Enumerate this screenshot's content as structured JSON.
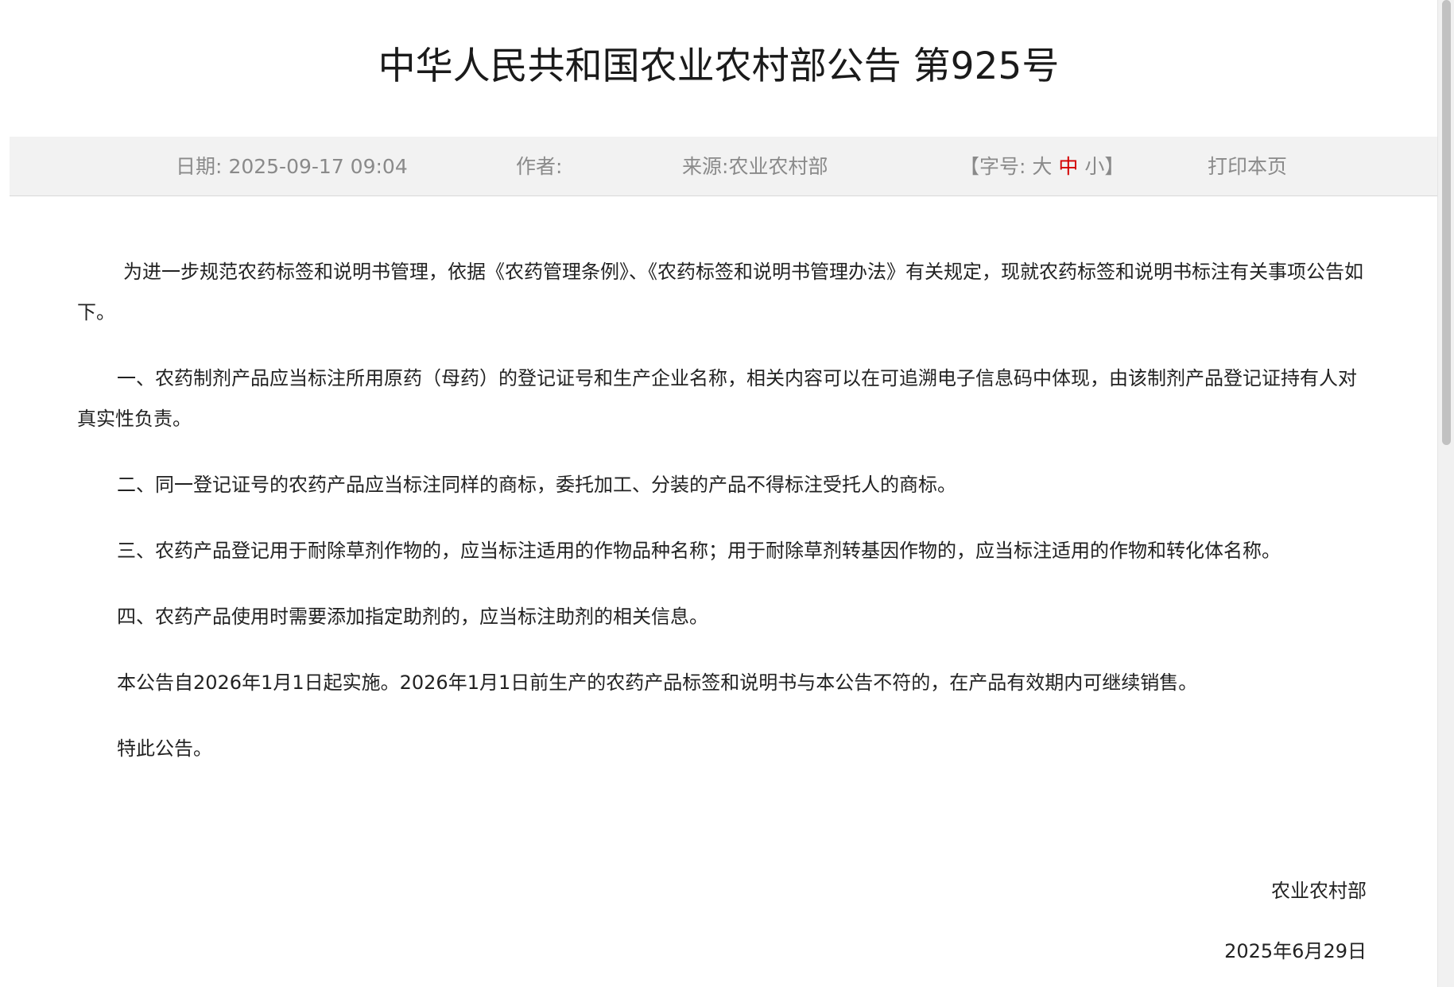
{
  "article": {
    "title": "中华人民共和国农业农村部公告 第925号"
  },
  "meta": {
    "date_label": "日期:",
    "date_value": "2025-09-17 09:04",
    "author_label": "作者:",
    "source_label": "来源:",
    "source_value": "农业农村部",
    "fontsize_open": "【字号:",
    "fontsize_large": "大",
    "fontsize_medium": "中",
    "fontsize_small": "小",
    "fontsize_close": "】",
    "fontsize_active": "中",
    "print_label": "打印本页",
    "active_color": "#d40000"
  },
  "body": {
    "paragraphs": [
      "为进一步规范农药标签和说明书管理，依据《农药管理条例》、《农药标签和说明书管理办法》有关规定，现就农药标签和说明书标注有关事项公告如下。",
      "一、农药制剂产品应当标注所用原药（母药）的登记证号和生产企业名称，相关内容可以在可追溯电子信息码中体现，由该制剂产品登记证持有人对真实性负责。",
      "二、同一登记证号的农药产品应当标注同样的商标，委托加工、分装的产品不得标注受托人的商标。",
      "三、农药产品登记用于耐除草剂作物的，应当标注适用的作物品种名称；用于耐除草剂转基因作物的，应当标注适用的作物和转化体名称。",
      "四、农药产品使用时需要添加指定助剂的，应当标注助剂的相关信息。",
      "本公告自2026年1月1日起实施。2026年1月1日前生产的农药产品标签和说明书与本公告不符的，在产品有效期内可继续销售。",
      "特此公告。"
    ]
  },
  "signature": {
    "org": "农业农村部",
    "date": "2025年6月29日"
  }
}
